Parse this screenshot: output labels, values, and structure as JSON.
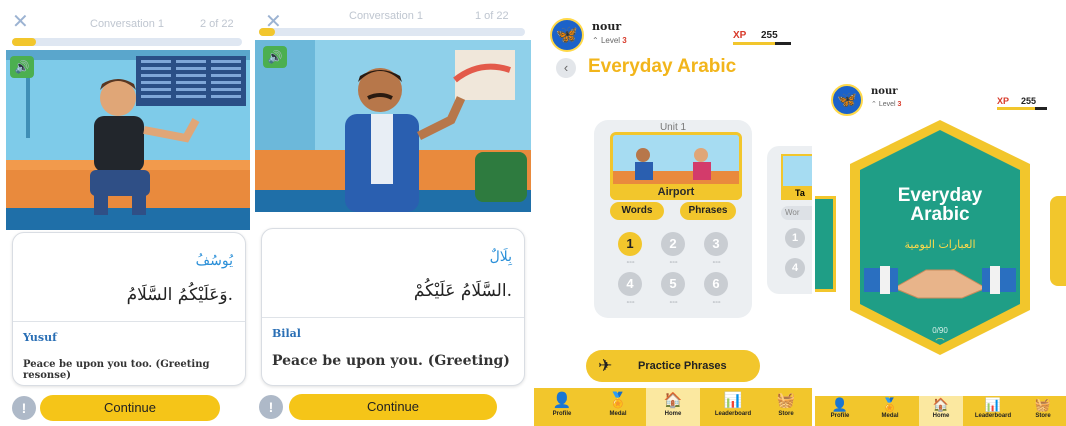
{
  "conversation_screens": [
    {
      "title": "Conversation 1",
      "counter": "2 of 22",
      "progress": 0.08,
      "speaker_name_ar": "يُوسُفُ",
      "line_ar": "وَعَلَيْكُمُ السَّلَامُ.",
      "speaker_name_en": "Yusuf",
      "translation": "Peace be upon you too. (Greeting resonse)",
      "continue_label": "Continue",
      "hint_label": "!"
    },
    {
      "title": "Conversation 1",
      "counter": "1 of 22",
      "progress": 0.05,
      "speaker_name_ar": "بِلَالٌ",
      "line_ar": "السَّلَامُ عَلَيْكُمْ.",
      "speaker_name_en": "Bilal",
      "translation": "Peace be upon you. (Greeting)",
      "continue_label": "Continue",
      "hint_label": "!"
    }
  ],
  "unit_screen": {
    "username": "nour",
    "level_label": "Level",
    "level_value": "3",
    "xp_label": "XP",
    "xp_value": "255",
    "course_title": "Everyday Arabic",
    "unit_label": "Unit 1",
    "lesson_name": "Airport",
    "words_label": "Words",
    "phrases_label": "Phrases",
    "lessons": [
      "1",
      "2",
      "3",
      "4",
      "5",
      "6"
    ],
    "active_lesson": "1",
    "next_card": {
      "lesson_partial": "Ta",
      "words_partial": "Wor",
      "lessons": [
        "1",
        "4"
      ]
    },
    "practice_label": "Practice Phrases"
  },
  "course_screen": {
    "username": "nour",
    "level_label": "Level",
    "level_value": "3",
    "xp_label": "XP",
    "xp_value": "255",
    "course_title_line1": "Everyday",
    "course_title_line2": "Arabic",
    "course_title_ar": "العبارات اليومية",
    "progress_text": "0/90"
  },
  "bottom_nav": [
    {
      "label": "Profile",
      "icon": "profile-icon",
      "glyph": "👤"
    },
    {
      "label": "Medal",
      "icon": "medal-icon",
      "glyph": "🏅"
    },
    {
      "label": "Home",
      "icon": "home-icon",
      "glyph": "🏠"
    },
    {
      "label": "Leaderboard",
      "icon": "leaderboard-icon",
      "glyph": "📊"
    },
    {
      "label": "Store",
      "icon": "store-icon",
      "glyph": "🧺"
    }
  ],
  "active_nav": "Home",
  "colors": {
    "accent_yellow": "#f2c62c",
    "name_blue": "#2a8fd8",
    "xp_red": "#d83a2a",
    "shield_teal": "#1f9e86"
  }
}
